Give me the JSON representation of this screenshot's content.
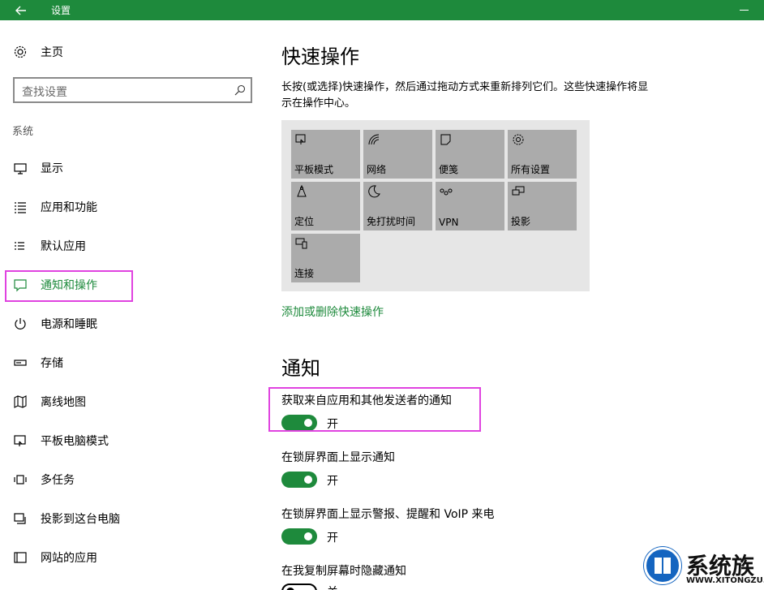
{
  "window": {
    "title": "设置"
  },
  "sidebar": {
    "home_label": "主页",
    "search_placeholder": "查找设置",
    "section_label": "系统",
    "items": [
      {
        "label": "显示",
        "icon": "monitor-icon"
      },
      {
        "label": "应用和功能",
        "icon": "list-icon"
      },
      {
        "label": "默认应用",
        "icon": "list-check-icon"
      },
      {
        "label": "通知和操作",
        "icon": "notification-icon",
        "active": true
      },
      {
        "label": "电源和睡眠",
        "icon": "power-icon"
      },
      {
        "label": "存储",
        "icon": "storage-icon"
      },
      {
        "label": "离线地图",
        "icon": "map-icon"
      },
      {
        "label": "平板电脑模式",
        "icon": "tablet-icon"
      },
      {
        "label": "多任务",
        "icon": "multitask-icon"
      },
      {
        "label": "投影到这台电脑",
        "icon": "project-icon"
      },
      {
        "label": "网站的应用",
        "icon": "web-apps-icon"
      }
    ]
  },
  "quick_actions": {
    "title": "快速操作",
    "description": "长按(或选择)快速操作，然后通过拖动方式来重新排列它们。这些快速操作将显示在操作中心。",
    "tiles": [
      {
        "label": "平板模式",
        "icon": "tablet-mode-icon"
      },
      {
        "label": "网络",
        "icon": "network-icon"
      },
      {
        "label": "便笺",
        "icon": "note-icon"
      },
      {
        "label": "所有设置",
        "icon": "gear-icon"
      },
      {
        "label": "定位",
        "icon": "location-icon"
      },
      {
        "label": "免打扰时间",
        "icon": "moon-icon"
      },
      {
        "label": "VPN",
        "icon": "vpn-icon"
      },
      {
        "label": "投影",
        "icon": "project-icon"
      },
      {
        "label": "连接",
        "icon": "connect-icon"
      }
    ],
    "link_label": "添加或删除快速操作"
  },
  "notifications": {
    "title": "通知",
    "settings": [
      {
        "label": "获取来自应用和其他发送者的通知",
        "state": "开",
        "on": true
      },
      {
        "label": "在锁屏界面上显示通知",
        "state": "开",
        "on": true
      },
      {
        "label": "在锁屏界面上显示警报、提醒和 VoIP 来电",
        "state": "开",
        "on": true
      },
      {
        "label": "在我复制屏幕时隐藏通知",
        "state": "关",
        "on": false
      }
    ]
  },
  "watermark": {
    "brand": "系统族",
    "url": "WWW.XITONGZU.COM"
  },
  "colors": {
    "accent": "#1e8a3c",
    "highlight": "#e043e0",
    "tile": "#ababab"
  }
}
